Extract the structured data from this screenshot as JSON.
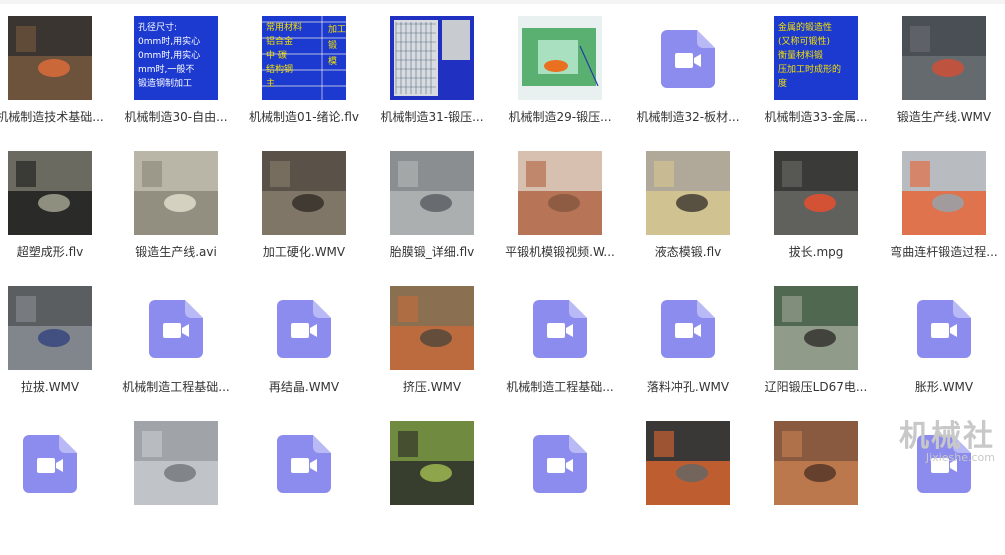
{
  "files": [
    {
      "name": "机械制造技术基础...",
      "thumb": "video-frame",
      "colors": [
        "#3a3530",
        "#7a5a40",
        "#d46a3a"
      ]
    },
    {
      "name": "机械制造30-自由...",
      "thumb": "slide-text",
      "lines": [
        "孔径尺寸:",
        "0mm时,用实心",
        "0mm时,用实心",
        "mm时,一般不",
        "锻造钢制加工"
      ]
    },
    {
      "name": "机械制造01-绪论.flv",
      "thumb": "slide-table",
      "lines": [
        "常用材料",
        "铝合金",
        "中 碳",
        "结构钢",
        "主",
        "加工",
        "锻",
        "模"
      ]
    },
    {
      "name": "机械制造31-锻压...",
      "thumb": "slide-grid"
    },
    {
      "name": "机械制造29-锻压...",
      "thumb": "diagram"
    },
    {
      "name": "机械制造32-板材...",
      "thumb": "video-icon"
    },
    {
      "name": "机械制造33-金属...",
      "thumb": "slide-text-yellow",
      "lines": [
        "金属的锻造性",
        "(又称可锻性)",
        "衡量材料锻",
        "压加工时成形的",
        "度"
      ]
    },
    {
      "name": "锻造生产线.WMV",
      "thumb": "video-frame",
      "colors": [
        "#4a4f55",
        "#6c7075",
        "#c8523a"
      ]
    },
    {
      "name": "超塑成形.flv",
      "thumb": "video-frame",
      "colors": [
        "#6a6a60",
        "#1a1a1a",
        "#9a9a8a"
      ]
    },
    {
      "name": "锻造生产线.avi",
      "thumb": "video-frame",
      "colors": [
        "#b9b6a8",
        "#8a8676",
        "#dcd8c8"
      ]
    },
    {
      "name": "加工硬化.WMV",
      "thumb": "video-frame",
      "colors": [
        "#5a5248",
        "#8a8070",
        "#3a342c"
      ]
    },
    {
      "name": "胎膜锻_详细.flv",
      "thumb": "video-frame",
      "colors": [
        "#8a8e90",
        "#b4b8b8",
        "#606468"
      ]
    },
    {
      "name": "平锻机模锻视频.W...",
      "thumb": "video-frame",
      "colors": [
        "#d8c0b0",
        "#b06040",
        "#8a5a40"
      ]
    },
    {
      "name": "液态模锻.flv",
      "thumb": "video-frame",
      "colors": [
        "#b0a898",
        "#d8c890",
        "#4a4438"
      ]
    },
    {
      "name": "拔长.mpg",
      "thumb": "video-frame",
      "colors": [
        "#3a3a38",
        "#6a6a66",
        "#e05030"
      ]
    },
    {
      "name": "弯曲连杆锻造过程...",
      "thumb": "video-frame",
      "colors": [
        "#b8bcc0",
        "#e86030",
        "#9aa0a6"
      ]
    },
    {
      "name": "拉拔.WMV",
      "thumb": "video-frame",
      "colors": [
        "#5a5e60",
        "#8a9096",
        "#3a4a80"
      ]
    },
    {
      "name": "机械制造工程基础...",
      "thumb": "video-icon"
    },
    {
      "name": "再结晶.WMV",
      "thumb": "video-icon"
    },
    {
      "name": "挤压.WMV",
      "thumb": "video-frame",
      "colors": [
        "#8a7050",
        "#c86a3a",
        "#5a4a3a"
      ]
    },
    {
      "name": "机械制造工程基础...",
      "thumb": "video-icon"
    },
    {
      "name": "落料冲孔.WMV",
      "thumb": "video-icon"
    },
    {
      "name": "辽阳锻压LD67电...",
      "thumb": "video-frame",
      "colors": [
        "#506850",
        "#a0a898",
        "#3a3a34"
      ]
    },
    {
      "name": "胀形.WMV",
      "thumb": "video-icon"
    },
    {
      "name": "",
      "thumb": "video-icon"
    },
    {
      "name": "",
      "thumb": "video-frame",
      "colors": [
        "#a0a4a8",
        "#c8ccd0",
        "#7a7e82"
      ]
    },
    {
      "name": "",
      "thumb": "video-icon"
    },
    {
      "name": "",
      "thumb": "video-frame",
      "colors": [
        "#708a40",
        "#2a2a28",
        "#98b050"
      ]
    },
    {
      "name": "",
      "thumb": "video-icon"
    },
    {
      "name": "",
      "thumb": "video-frame",
      "colors": [
        "#3a3836",
        "#e06830",
        "#6a6662"
      ]
    },
    {
      "name": "",
      "thumb": "video-frame",
      "colors": [
        "#8a5a40",
        "#c88050",
        "#5a3a2a"
      ]
    },
    {
      "name": "",
      "thumb": "video-icon"
    }
  ],
  "icon_colors": {
    "video_icon_bg": "#8c8cee",
    "video_icon_fold": "#b9b9f6",
    "slide_bg": "#1c3ad0",
    "slide_text": "#ffffff",
    "slide_yellow": "#f4e000"
  },
  "watermark": {
    "text": "机械社",
    "sub": "Jixieshe.com"
  }
}
